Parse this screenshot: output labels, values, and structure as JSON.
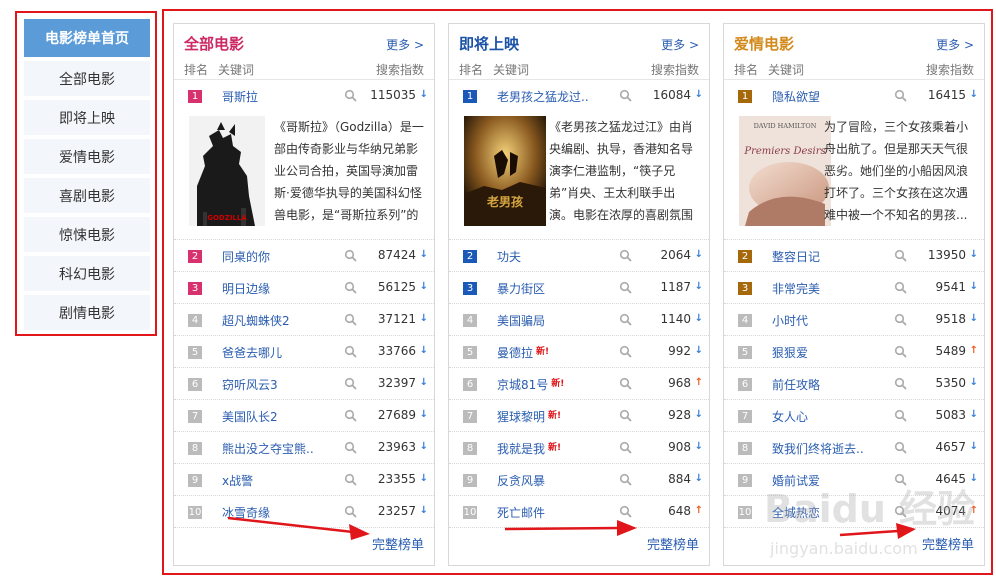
{
  "sidebar": {
    "home": "电影榜单首页",
    "items": [
      "全部电影",
      "即将上映",
      "爱情电影",
      "喜剧电影",
      "惊悚电影",
      "科幻电影",
      "剧情电影"
    ]
  },
  "columns": {
    "rank": "排名",
    "keyword": "关键词",
    "index": "搜索指数"
  },
  "more_label": "更多 >",
  "full_list_label": "完整榜单",
  "colors": {
    "panel1_title": "#cc2a64",
    "panel2_title": "#1a52a8",
    "panel3_title": "#d28a1c",
    "rank_top_panel1": "#d8326e",
    "rank_top_panel2": "#1a59b8",
    "rank_top_panel3": "#a5690c",
    "rank_other": "#bbbbbb"
  },
  "panels": [
    {
      "title": "全部电影",
      "detail": "《哥斯拉》（Godzilla）是一部由传奇影业与华纳兄弟影业公司合拍，英国导演加雷斯·爱德华执导的美国科幻怪兽电影，是“哥斯拉系列”的重启、美国...",
      "rows": [
        {
          "rank": "1",
          "name": "哥斯拉",
          "value": "115035",
          "trend": "down"
        },
        {
          "rank": "2",
          "name": "同桌的你",
          "value": "87424",
          "trend": "down"
        },
        {
          "rank": "3",
          "name": "明日边缘",
          "value": "56125",
          "trend": "down"
        },
        {
          "rank": "4",
          "name": "超凡蜘蛛侠2",
          "value": "37121",
          "trend": "down"
        },
        {
          "rank": "5",
          "name": "爸爸去哪儿",
          "value": "33766",
          "trend": "down"
        },
        {
          "rank": "6",
          "name": "窃听风云3",
          "value": "32397",
          "trend": "down"
        },
        {
          "rank": "7",
          "name": "美国队长2",
          "value": "27689",
          "trend": "down"
        },
        {
          "rank": "8",
          "name": "熊出没之夺宝熊..",
          "value": "23963",
          "trend": "down"
        },
        {
          "rank": "9",
          "name": "x战警",
          "value": "23355",
          "trend": "down"
        },
        {
          "rank": "10",
          "name": "冰雪奇缘",
          "value": "23257",
          "trend": "down"
        }
      ]
    },
    {
      "title": "即将上映",
      "detail": "《老男孩之猛龙过江》由肖央编剧、执导，香港知名导演李仁港监制，“筷子兄弟”肖央、王太利联手出演。电影在浓厚的喜剧氛围下，讲述了两...",
      "rows": [
        {
          "rank": "1",
          "name": "老男孩之猛龙过..",
          "value": "16084",
          "trend": "down"
        },
        {
          "rank": "2",
          "name": "功夫",
          "value": "2064",
          "trend": "down"
        },
        {
          "rank": "3",
          "name": "暴力街区",
          "value": "1187",
          "trend": "down"
        },
        {
          "rank": "4",
          "name": "美国骗局",
          "value": "1140",
          "trend": "down"
        },
        {
          "rank": "5",
          "name": "曼德拉",
          "value": "992",
          "trend": "down",
          "new": "新!"
        },
        {
          "rank": "6",
          "name": "京城81号",
          "value": "968",
          "trend": "up",
          "new": "新!"
        },
        {
          "rank": "7",
          "name": "猩球黎明",
          "value": "928",
          "trend": "down",
          "new": "新!"
        },
        {
          "rank": "8",
          "name": "我就是我",
          "value": "908",
          "trend": "down",
          "new": "新!"
        },
        {
          "rank": "9",
          "name": "反贪风暴",
          "value": "884",
          "trend": "down"
        },
        {
          "rank": "10",
          "name": "死亡邮件",
          "value": "648",
          "trend": "up"
        }
      ]
    },
    {
      "title": "爱情电影",
      "detail": "为了冒险，三个女孩乘着小舟出航了。但是那天天气很恶劣。她们坐的小船因风浪打坏了。三个女孩在这次遇难中被一个不知名的男孩...",
      "poster_text": "DAVID HAMILTON",
      "poster_script": "Premiers Desirs",
      "rows": [
        {
          "rank": "1",
          "name": "隐私欲望",
          "value": "16415",
          "trend": "down"
        },
        {
          "rank": "2",
          "name": "整容日记",
          "value": "13950",
          "trend": "down"
        },
        {
          "rank": "3",
          "name": "非常完美",
          "value": "9541",
          "trend": "down"
        },
        {
          "rank": "4",
          "name": "小时代",
          "value": "9518",
          "trend": "down"
        },
        {
          "rank": "5",
          "name": "狠狠爱",
          "value": "5489",
          "trend": "up"
        },
        {
          "rank": "6",
          "name": "前任攻略",
          "value": "5350",
          "trend": "down"
        },
        {
          "rank": "7",
          "name": "女人心",
          "value": "5083",
          "trend": "down"
        },
        {
          "rank": "8",
          "name": "致我们终将逝去..",
          "value": "4657",
          "trend": "down"
        },
        {
          "rank": "9",
          "name": "婚前试爱",
          "value": "4645",
          "trend": "down"
        },
        {
          "rank": "10",
          "name": "全城热恋",
          "value": "4074",
          "trend": "up"
        }
      ]
    }
  ],
  "watermark": {
    "logo": "Baidu 经验",
    "url": "jingyan.baidu.com"
  }
}
